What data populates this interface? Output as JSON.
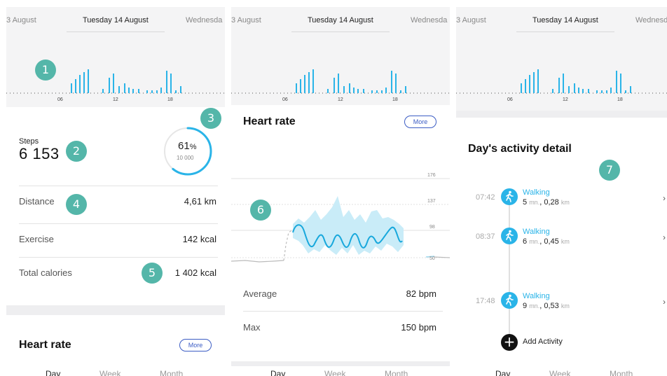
{
  "dates": {
    "prev": "3 August",
    "current": "Tuesday 14 August",
    "next": "Wednesda"
  },
  "chart_hours": [
    "06",
    "12",
    "18"
  ],
  "colors": {
    "accent": "#2ab4e8",
    "badge": "#54b6a9",
    "more_border": "#3b5cc4"
  },
  "badges": [
    "1",
    "2",
    "3",
    "4",
    "5",
    "6",
    "7"
  ],
  "panel1": {
    "steps_label": "Steps",
    "steps_value": "6 153",
    "goal_percent": "61",
    "goal_percent_sign": "%",
    "goal_value": "10 000",
    "goal_progress": 0.61,
    "rows": [
      {
        "label": "Distance",
        "value": "4,61 km"
      },
      {
        "label": "Exercise",
        "value": "142 kcal"
      },
      {
        "label": "Total calories",
        "value": "1 402 kcal"
      }
    ],
    "heart_title": "Heart rate",
    "more_label": "More",
    "tabs": [
      "Day",
      "Week",
      "Month"
    ]
  },
  "panel2": {
    "title": "Heart rate",
    "more_label": "More",
    "scale": [
      "176",
      "137",
      "98",
      "50"
    ],
    "rows": [
      {
        "label": "Average",
        "value": "82 bpm"
      },
      {
        "label": "Max",
        "value": "150 bpm"
      }
    ],
    "tabs": [
      "Day",
      "Week",
      "Month"
    ]
  },
  "panel3": {
    "title": "Day's activity detail",
    "activities": [
      {
        "time": "07:42",
        "name": "Walking",
        "minutes": "5",
        "min_unit": "mn.",
        "distance": "0,28",
        "dist_unit": "km"
      },
      {
        "time": "08:37",
        "name": "Walking",
        "minutes": "6",
        "min_unit": "mn.",
        "distance": "0,45",
        "dist_unit": "km"
      },
      {
        "time": "17:48",
        "name": "Walking",
        "minutes": "9",
        "min_unit": "mn.",
        "distance": "0,53",
        "dist_unit": "km"
      }
    ],
    "add_label": "Add Activity",
    "tabs": [
      "Day",
      "Week",
      "Month"
    ]
  }
}
